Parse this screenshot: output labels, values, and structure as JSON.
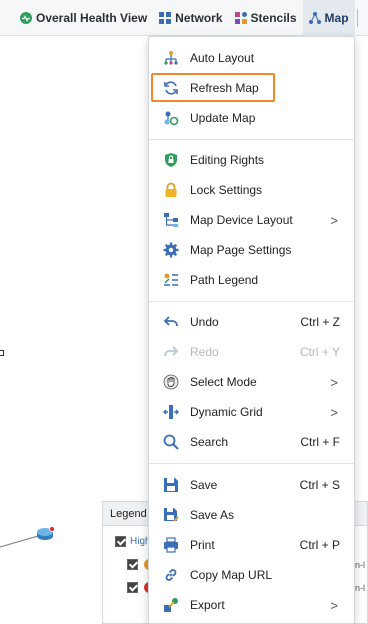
{
  "toolbar": {
    "items": [
      {
        "label": "Overall Health View",
        "icon": "health-icon",
        "color": "#2e9e5b"
      },
      {
        "label": "Network",
        "icon": "network-icon",
        "color": "#3a6fb5"
      },
      {
        "label": "Stencils",
        "icon": "stencils-icon",
        "color": "#c2448a"
      },
      {
        "label": "Map",
        "icon": "map-icon",
        "color": "#3a6fb5"
      }
    ]
  },
  "legend": {
    "title": "Legend",
    "row1": "High",
    "side1": "n-l",
    "side2": "n-l"
  },
  "menu": {
    "items": [
      {
        "label": "Auto Layout",
        "shortcut": "",
        "submenu": false,
        "icon": "auto-layout-icon"
      },
      {
        "label": "Refresh Map",
        "shortcut": "",
        "submenu": false,
        "icon": "refresh-icon"
      },
      {
        "label": "Update Map",
        "shortcut": "",
        "submenu": false,
        "icon": "update-map-icon"
      },
      {
        "label": "Editing Rights",
        "shortcut": "",
        "submenu": false,
        "icon": "shield-icon"
      },
      {
        "label": "Lock Settings",
        "shortcut": "",
        "submenu": false,
        "icon": "lock-icon"
      },
      {
        "label": "Map Device Layout",
        "shortcut": "",
        "submenu": true,
        "icon": "device-layout-icon"
      },
      {
        "label": "Map Page Settings",
        "shortcut": "",
        "submenu": false,
        "icon": "gear-icon"
      },
      {
        "label": "Path Legend",
        "shortcut": "",
        "submenu": false,
        "icon": "path-legend-icon"
      },
      {
        "label": "Undo",
        "shortcut": "Ctrl + Z",
        "submenu": false,
        "icon": "undo-icon"
      },
      {
        "label": "Redo",
        "shortcut": "Ctrl + Y",
        "submenu": false,
        "icon": "redo-icon",
        "disabled": true
      },
      {
        "label": "Select Mode",
        "shortcut": "",
        "submenu": true,
        "icon": "hand-icon"
      },
      {
        "label": "Dynamic Grid",
        "shortcut": "",
        "submenu": true,
        "icon": "grid-icon"
      },
      {
        "label": "Search",
        "shortcut": "Ctrl + F",
        "submenu": false,
        "icon": "search-icon"
      },
      {
        "label": "Save",
        "shortcut": "Ctrl + S",
        "submenu": false,
        "icon": "save-icon"
      },
      {
        "label": "Save As",
        "shortcut": "",
        "submenu": false,
        "icon": "save-as-icon"
      },
      {
        "label": "Print",
        "shortcut": "Ctrl + P",
        "submenu": false,
        "icon": "print-icon"
      },
      {
        "label": "Copy Map URL",
        "shortcut": "",
        "submenu": false,
        "icon": "link-icon"
      },
      {
        "label": "Export",
        "shortcut": "",
        "submenu": true,
        "icon": "export-icon"
      }
    ],
    "arrow": ">"
  },
  "colors": {
    "highlight": "#f0872a",
    "accent": "#3a6fb5"
  }
}
